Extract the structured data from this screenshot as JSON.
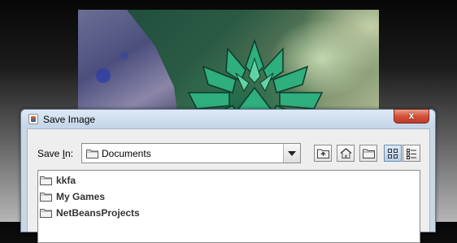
{
  "dialog": {
    "title": "Save Image",
    "close_symbol": "x",
    "save_in_label_prefix": "Save ",
    "save_in_label_mnemonic": "I",
    "save_in_label_suffix": "n:",
    "location": {
      "value": "Documents",
      "icon": "folder-icon"
    },
    "toolbar": [
      {
        "name": "up-one-level-button",
        "icon": "folder-up-icon",
        "selected": false
      },
      {
        "name": "home-button",
        "icon": "home-icon",
        "selected": false
      },
      {
        "name": "new-folder-button",
        "icon": "new-folder-icon",
        "selected": false
      },
      {
        "name": "list-view-button",
        "icon": "list-view-icon",
        "selected": true
      },
      {
        "name": "details-view-button",
        "icon": "details-view-icon",
        "selected": false
      }
    ],
    "files": [
      {
        "name": "kkfa",
        "icon": "folder-icon"
      },
      {
        "name": "My Games",
        "icon": "folder-icon"
      },
      {
        "name": "NetBeansProjects",
        "icon": "folder-icon"
      }
    ]
  },
  "colors": {
    "dialog_frame": "#c9d7e6",
    "close_button": "#d4513a",
    "flower": "#2fae7e"
  }
}
